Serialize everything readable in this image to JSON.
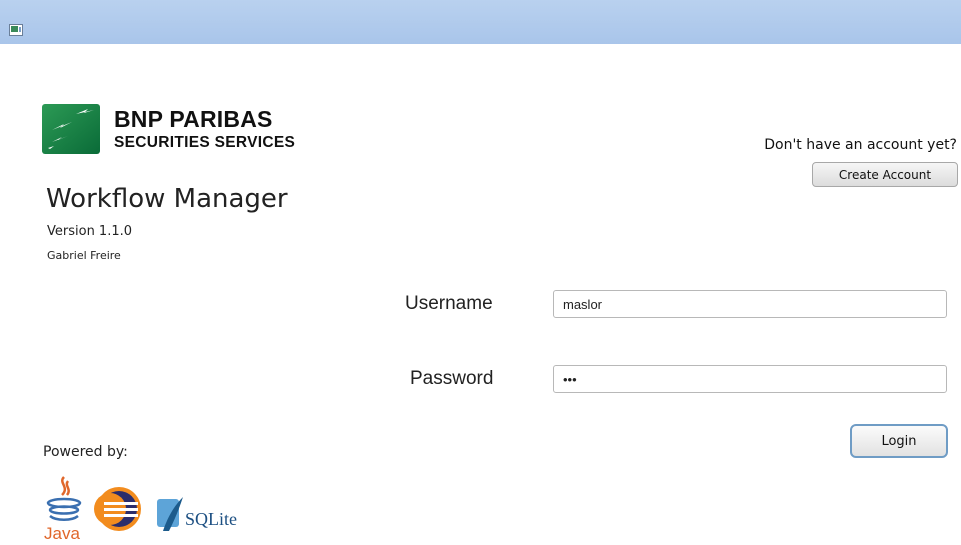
{
  "brand": {
    "name": "BNP PARIBAS",
    "division": "SECURITIES SERVICES"
  },
  "app": {
    "title": "Workflow Manager",
    "version": "Version 1.1.0",
    "author": "Gabriel Freire"
  },
  "account": {
    "prompt": "Don't have an account yet?",
    "create_label": "Create Account"
  },
  "login": {
    "username_label": "Username",
    "username_value": "maslor",
    "password_label": "Password",
    "password_value": "•••",
    "login_label": "Login"
  },
  "footer": {
    "powered_by": "Powered by:",
    "java_label": "Java",
    "sqlite_label": "SQLite"
  },
  "colors": {
    "titlebar": "#b3cdee",
    "bnp_green": "#0f8046",
    "login_border": "#6f9cc5"
  },
  "icons": [
    "window-icon",
    "bnp-logo-icon",
    "java-icon",
    "eclipse-icon",
    "sqlite-icon"
  ]
}
